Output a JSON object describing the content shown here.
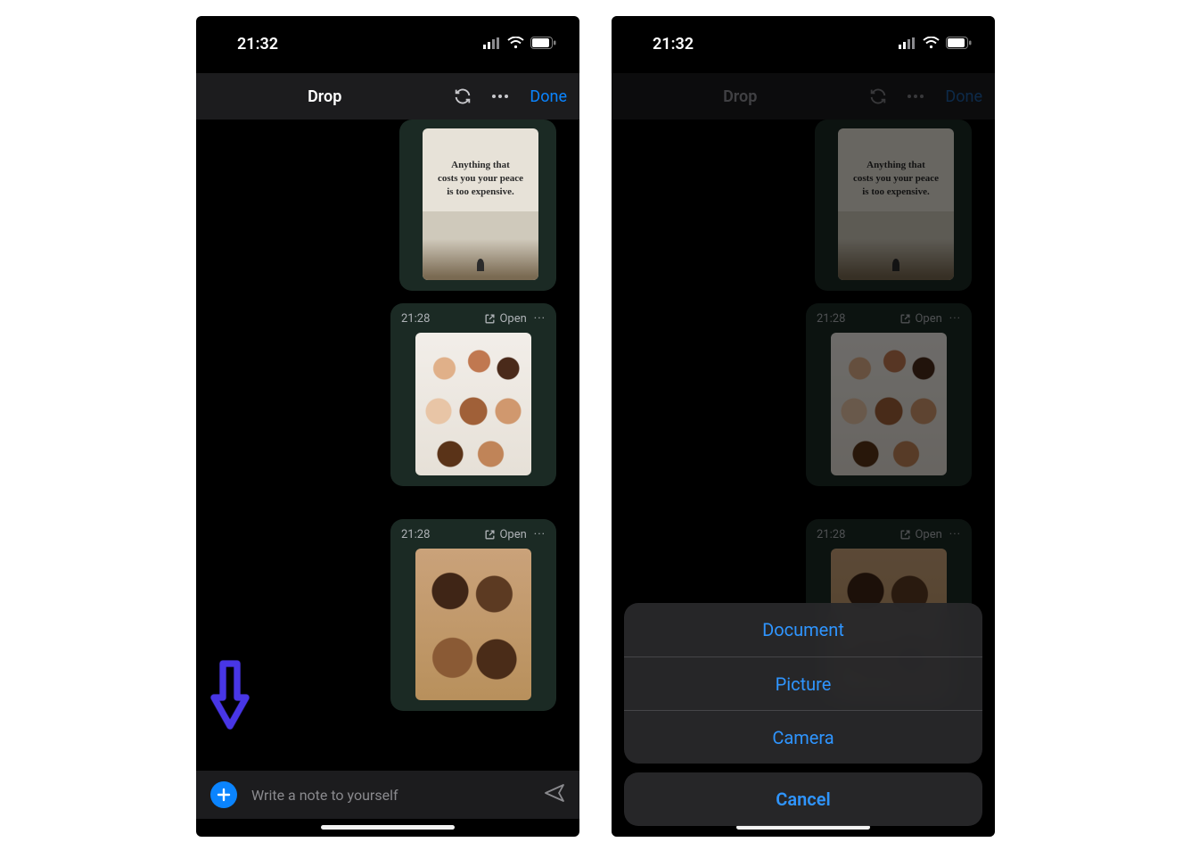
{
  "status": {
    "time": "21:32"
  },
  "header": {
    "title": "Drop",
    "done": "Done"
  },
  "messages": [
    {
      "time": null,
      "open": null,
      "quote_line1": "Anything that",
      "quote_line2": "costs you your peace",
      "quote_line3": "is too expensive."
    },
    {
      "time": "21:28",
      "open": "Open"
    },
    {
      "time": "21:28",
      "open": "Open"
    }
  ],
  "composer": {
    "placeholder": "Write a note to yourself"
  },
  "sheet": {
    "options": [
      "Document",
      "Picture",
      "Camera"
    ],
    "cancel": "Cancel"
  }
}
